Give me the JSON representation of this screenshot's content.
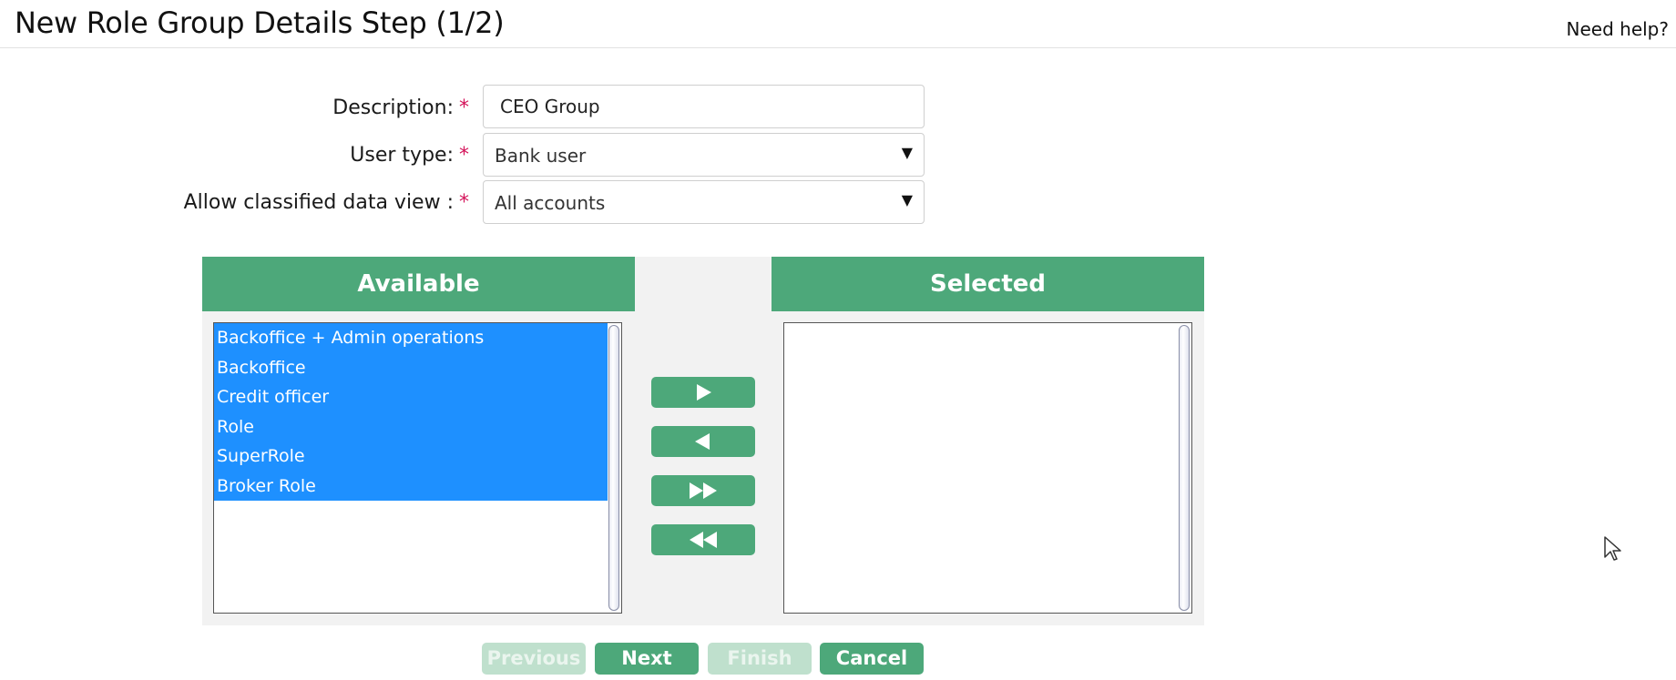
{
  "header": {
    "title": "New Role Group Details Step (1/2)",
    "help_link": "Need help?"
  },
  "form": {
    "description": {
      "label": "Description:",
      "required_mark": "*",
      "value": "CEO Group"
    },
    "user_type": {
      "label": "User type:",
      "required_mark": "*",
      "selected": "Bank user"
    },
    "classified_view": {
      "label": "Allow classified data view :",
      "required_mark": "*",
      "selected": "All accounts"
    }
  },
  "transfer": {
    "available_header": "Available",
    "selected_header": "Selected",
    "available_items": [
      "Backoffice + Admin operations",
      "Backoffice",
      "Credit officer",
      "Role",
      "SuperRole",
      "Broker Role"
    ],
    "selected_items": [],
    "highlight_color": "#1e90ff",
    "accent_color": "#4da87a",
    "controls": [
      "move-right-icon",
      "move-left-icon",
      "move-all-right-icon",
      "move-all-left-icon"
    ]
  },
  "footer": {
    "previous_label": "Previous",
    "next_label": "Next",
    "finish_label": "Finish",
    "cancel_label": "Cancel"
  }
}
